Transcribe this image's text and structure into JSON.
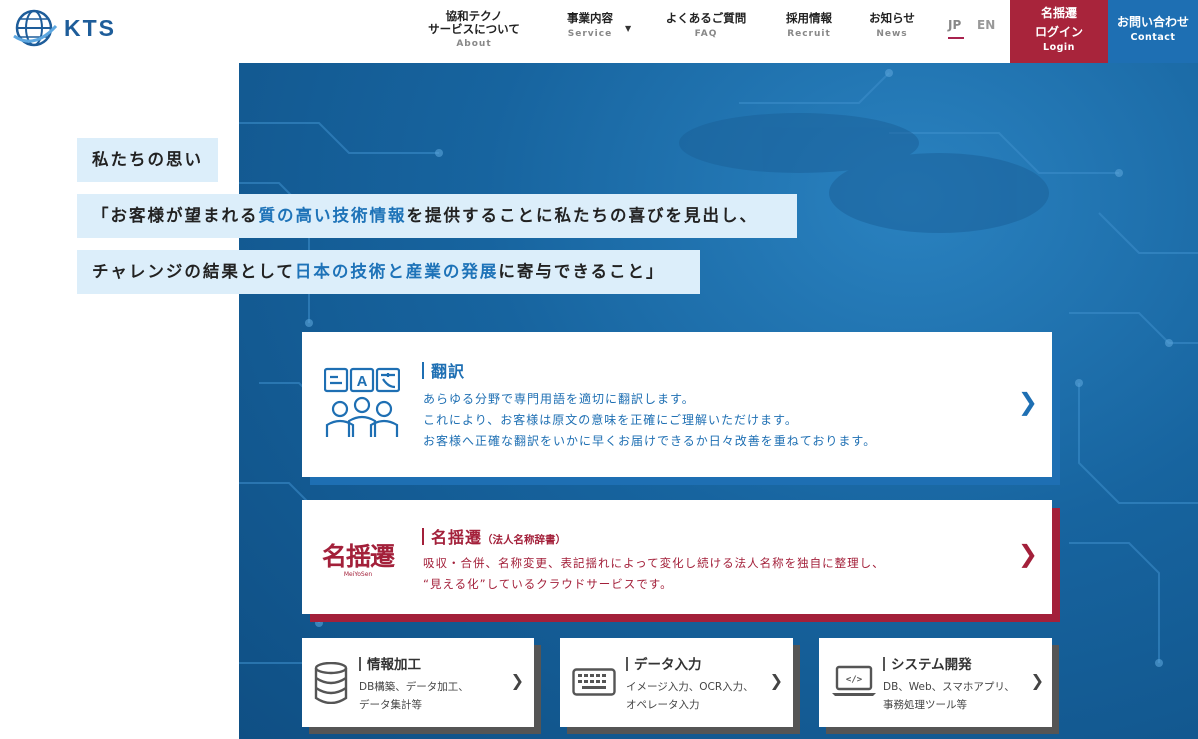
{
  "brand": {
    "name": "KTS"
  },
  "nav": [
    {
      "ja": "協和テクノ\nサービスについて",
      "ja_line1": "協和テクノ",
      "ja_line2": "サービスについて",
      "en": "About"
    },
    {
      "ja": "事業内容",
      "en": "Service"
    },
    {
      "ja": "よくあるご質問",
      "en": "FAQ"
    },
    {
      "ja": "採用情報",
      "en": "Recruit"
    },
    {
      "ja": "お知らせ",
      "en": "News"
    }
  ],
  "lang": {
    "jp": "JP",
    "en": "EN"
  },
  "login": {
    "line1": "名揺遷",
    "line2": "ログイン",
    "en": "Login"
  },
  "contact": {
    "ja": "お問い合わせ",
    "en": "Contact"
  },
  "philosophy": {
    "heading": "私たちの思い",
    "line1_pre": "「お客様が望まれる",
    "line1_hl": "質の高い技術情報",
    "line1_post": "を提供することに私たちの喜びを見出し、",
    "line2_pre": "チャレンジの結果として",
    "line2_hl": "日本の技術と産業の発展",
    "line2_post": "に寄与できること」"
  },
  "services": {
    "translation": {
      "title": "翻訳",
      "icon_text": "A",
      "desc": [
        "あらゆる分野で専門用語を適切に翻訳します。",
        "これにより、お客様は原文の意味を正確にご理解いただけます。",
        "お客様へ正確な翻訳をいかに早くお届けできるか日々改善を重ねております。"
      ]
    },
    "meiyosen": {
      "title": "名揺遷",
      "subtitle": "（法人名称辞書）",
      "logo_text": "名揺遷",
      "logo_sub": "MeiYoSen",
      "desc": [
        "吸収・合併、名称変更、表記揺れによって変化し続ける法人名称を独自に整理し、",
        "“見える化”しているクラウドサービスです。"
      ]
    },
    "small": [
      {
        "title": "情報加工",
        "desc": [
          "DB構築、データ加工、",
          "データ集計等"
        ],
        "icon": "database-icon"
      },
      {
        "title": "データ入力",
        "desc": [
          "イメージ入力、OCR入力、",
          "オペレータ入力"
        ],
        "icon": "keyboard-icon"
      },
      {
        "title": "システム開発",
        "desc": [
          "DB、Web、スマホアプリ、",
          "事務処理ツール等"
        ],
        "icon": "laptop-code-icon"
      }
    ]
  },
  "colors": {
    "primary": "#1e6fb3",
    "accent_red": "#a8243b",
    "highlight_bg": "#dceefa"
  }
}
